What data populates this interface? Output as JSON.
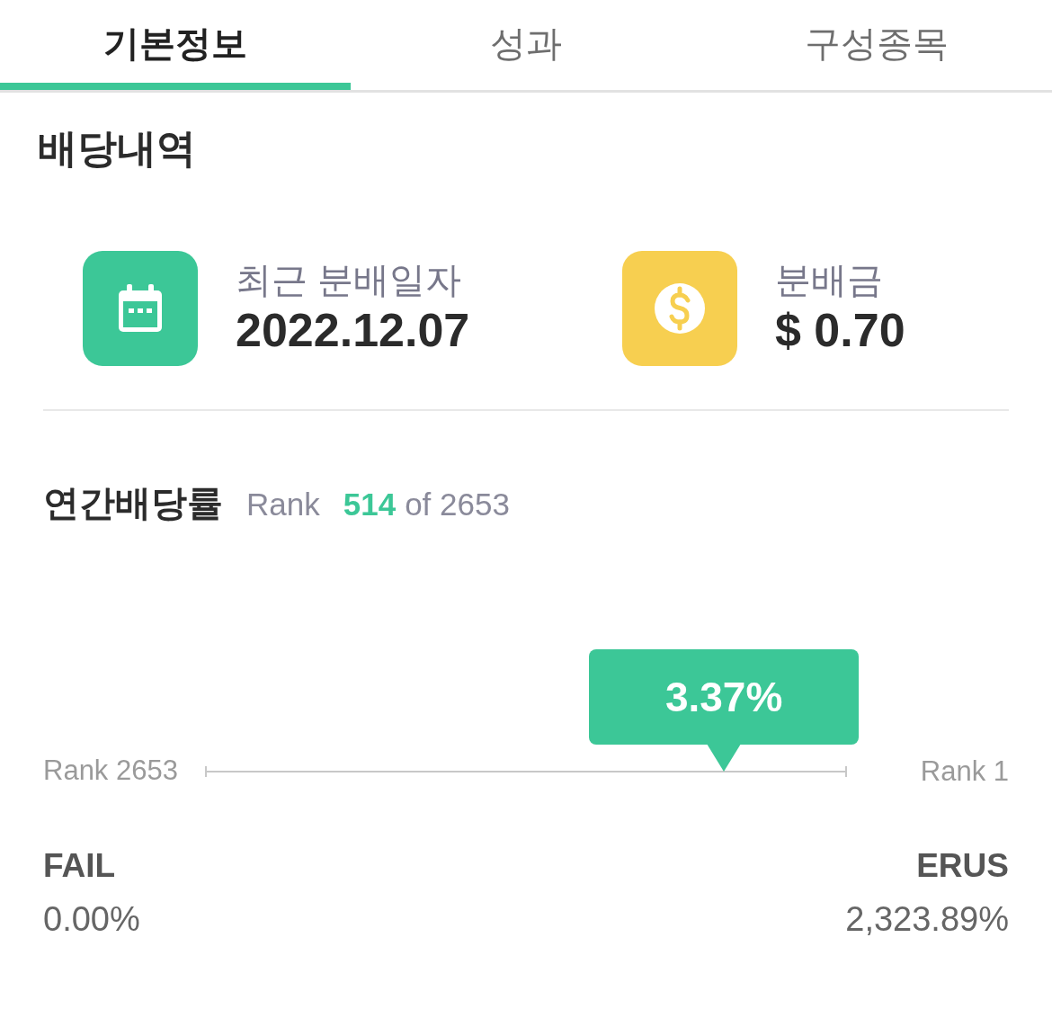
{
  "tabs": [
    {
      "label": "기본정보",
      "selected": true
    },
    {
      "label": "성과",
      "selected": false
    },
    {
      "label": "구성종목",
      "selected": false
    }
  ],
  "dividend_history": {
    "title": "배당내역",
    "items": [
      {
        "kind": "date",
        "label": "최근 분배일자",
        "value": "2022.12.07",
        "color": "#3cc797"
      },
      {
        "kind": "amount",
        "label": "분배금",
        "value": "$ 0.70",
        "color": "#f7cf50"
      }
    ]
  },
  "annual_yield": {
    "title": "연간배당률",
    "rank_label": "Rank",
    "rank": "514",
    "rank_total": "of 2653",
    "slider": {
      "start_label": "Rank 2653",
      "end_label": "Rank 1",
      "level": 0.81,
      "value": "3.37%"
    },
    "low": {
      "name": "FAIL",
      "value": "0.00%"
    },
    "high": {
      "name": "ERUS",
      "value": "2,323.89%"
    }
  }
}
